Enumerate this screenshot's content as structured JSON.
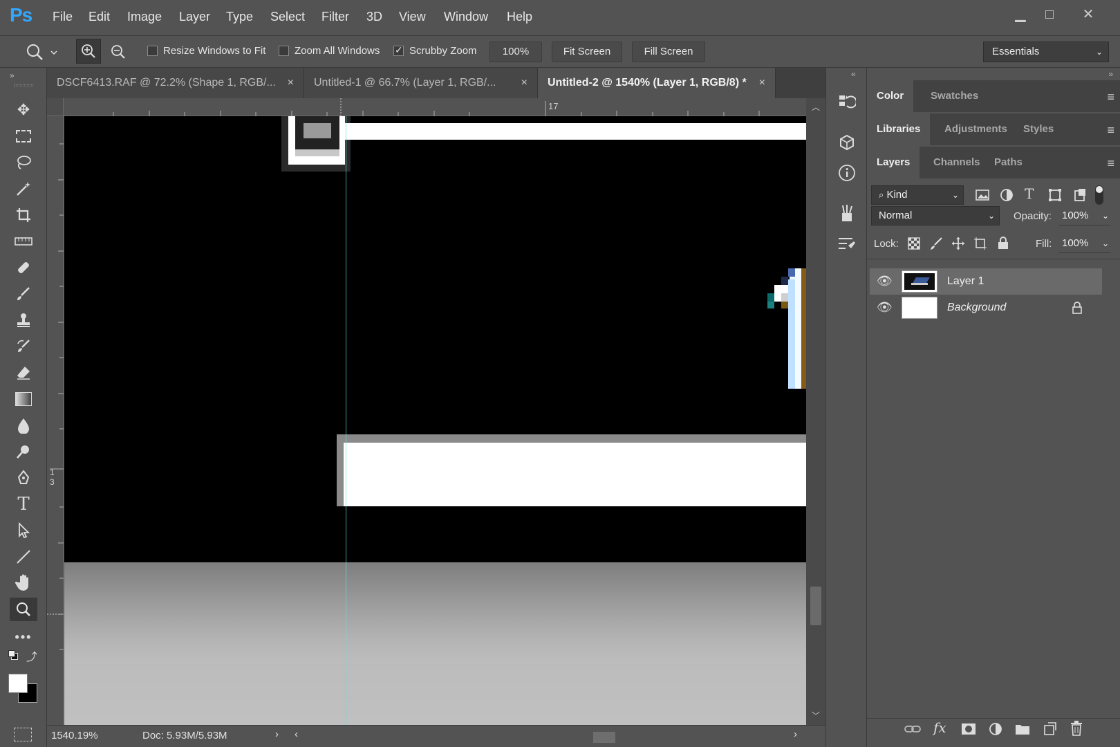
{
  "app": {
    "logo": "Ps"
  },
  "menu": [
    "File",
    "Edit",
    "Image",
    "Layer",
    "Type",
    "Select",
    "Filter",
    "3D",
    "View",
    "Window",
    "Help"
  ],
  "window_controls": {
    "minimize": "▁",
    "maximize": "□",
    "close": "✕"
  },
  "options": {
    "resize_windows": "Resize Windows to Fit",
    "resize_windows_checked": false,
    "zoom_all": "Zoom All Windows",
    "zoom_all_checked": false,
    "scrubby": "Scrubby Zoom",
    "scrubby_checked": true,
    "zoom_100": "100%",
    "fit_screen": "Fit Screen",
    "fill_screen": "Fill Screen",
    "workspace": "Essentials"
  },
  "tabs": [
    {
      "label": "DSCF6413.RAF @ 72.2% (Shape 1, RGB/...",
      "close": "×"
    },
    {
      "label": "Untitled-1 @ 66.7% (Layer 1, RGB/...",
      "close": "×"
    },
    {
      "label": "Untitled-2 @ 1540% (Layer 1, RGB/8) *",
      "close": "×"
    }
  ],
  "ruler": {
    "top_label": "17",
    "left_label_1": "1",
    "left_label_2": "3"
  },
  "status": {
    "zoom": "1540.19%",
    "doc": "Doc: 5.93M/5.93M"
  },
  "panels": {
    "row1": [
      "Color",
      "Swatches"
    ],
    "row2": [
      "Libraries",
      "Adjustments",
      "Styles"
    ],
    "row3": [
      "Layers",
      "Channels",
      "Paths"
    ],
    "kind": "Kind",
    "blend_mode": "Normal",
    "opacity_label": "Opacity:",
    "opacity_value": "100%",
    "lock_label": "Lock:",
    "fill_label": "Fill:",
    "fill_value": "100%",
    "layers": [
      {
        "name": "Layer 1",
        "selected": true
      },
      {
        "name": "Background",
        "selected": false,
        "locked": true
      }
    ]
  },
  "colors": {
    "accent": "#31a8ff",
    "ui_bg": "#535353",
    "canvas": "#000000"
  }
}
